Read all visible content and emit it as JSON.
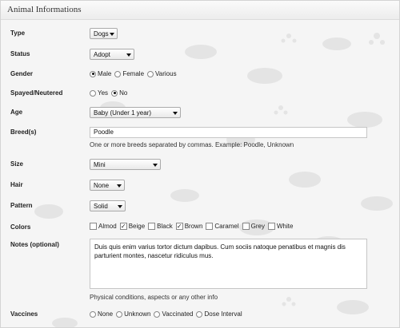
{
  "panel": {
    "title": "Animal Informations"
  },
  "type": {
    "label": "Type",
    "value": "Dogs"
  },
  "status": {
    "label": "Status",
    "value": "Adopt"
  },
  "gender": {
    "label": "Gender",
    "options": [
      "Male",
      "Female",
      "Various"
    ],
    "selected": "Male"
  },
  "spayed": {
    "label": "Spayed/Neutered",
    "options": [
      "Yes",
      "No"
    ],
    "selected": "No"
  },
  "age": {
    "label": "Age",
    "value": "Baby (Under 1 year)"
  },
  "breeds": {
    "label": "Breed(s)",
    "value": "Poodle",
    "hint": "One or more breeds separated by commas. Example: Poodle, Unknown"
  },
  "size": {
    "label": "Size",
    "value": "Mini"
  },
  "hair": {
    "label": "Hair",
    "value": "None"
  },
  "pattern": {
    "label": "Pattern",
    "value": "Solid"
  },
  "colors": {
    "label": "Colors",
    "options": [
      "Almod",
      "Beige",
      "Black",
      "Brown",
      "Caramel",
      "Grey",
      "White"
    ],
    "checked": [
      "Beige",
      "Brown"
    ]
  },
  "notes": {
    "label": "Notes (optional)",
    "value": "Duis quis enim varius tortor dictum dapibus. Cum sociis natoque penatibus et magnis dis parturient montes, nascetur ridiculus mus.",
    "hint": "Physical conditions, aspects or any other info"
  },
  "vaccines": {
    "label": "Vaccines",
    "options": [
      "None",
      "Unknown",
      "Vaccinated",
      "Dose Interval"
    ]
  },
  "colors_theme": {
    "panel_bg": "#f5f5f5",
    "border": "#d4d4d4",
    "watermark": "#e6e6e6"
  }
}
